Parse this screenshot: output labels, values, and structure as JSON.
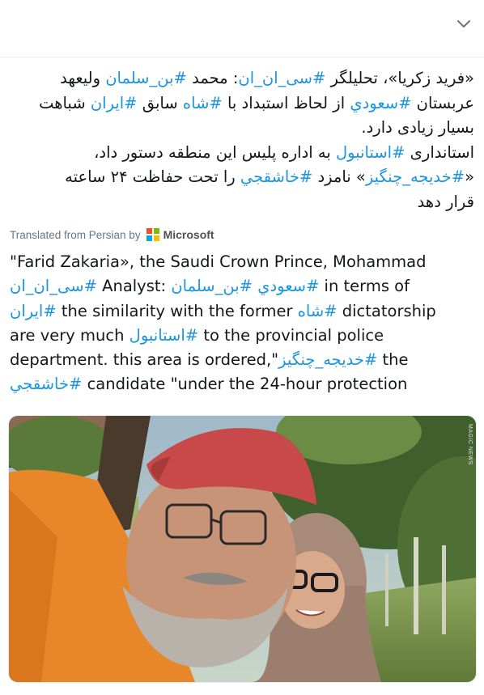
{
  "header": {
    "chevron_icon": "chevron-down-icon"
  },
  "tweet": {
    "persian_lines": [
      [
        {
          "t": "«فرید زکریا»، تحلیلگر ",
          "tag": false
        },
        {
          "t": "#سی_ان_ان",
          "tag": true
        },
        {
          "t": ": محمد ",
          "tag": false
        },
        {
          "t": "#بن_سلمان",
          "tag": true
        },
        {
          "t": " ولیعهد",
          "tag": false
        }
      ],
      [
        {
          "t": "عربستان ",
          "tag": false
        },
        {
          "t": "#سعودي",
          "tag": true
        },
        {
          "t": " از لحاظ استبداد با ",
          "tag": false
        },
        {
          "t": "#شاه",
          "tag": true
        },
        {
          "t": " سابق ",
          "tag": false
        },
        {
          "t": "#ایران",
          "tag": true
        },
        {
          "t": " شباهت",
          "tag": false
        }
      ],
      [
        {
          "t": "بسیار زیادی دارد.",
          "tag": false
        }
      ],
      [
        {
          "t": "استانداری ",
          "tag": false
        },
        {
          "t": "#استانبول",
          "tag": true
        },
        {
          "t": " به اداره پلیس این منطقه دستور داد،",
          "tag": false
        }
      ],
      [
        {
          "t": "«",
          "tag": false
        },
        {
          "t": "#خدیجه_چنگیز",
          "tag": true
        },
        {
          "t": "» نامزد ",
          "tag": false
        },
        {
          "t": "#خاشقجي",
          "tag": true
        },
        {
          "t": "  را تحت حفاظت ۲۴ ساعته",
          "tag": false
        }
      ],
      [
        {
          "t": "قرار دهد",
          "tag": false
        }
      ]
    ],
    "translated_label": "Translated from Persian by",
    "microsoft_label": "Microsoft",
    "ms_colors": [
      "#f25022",
      "#7fba00",
      "#00a4ef",
      "#ffb900"
    ],
    "english_lines": [
      [
        {
          "t": "\"Farid Zakaria», the Saudi Crown Prince, Mohammad",
          "tag": false
        }
      ],
      [
        {
          "t": "#سی_ان_ان",
          "tag": true
        },
        {
          "t": " Analyst: ",
          "tag": false
        },
        {
          "t": "#بن_سلمان",
          "tag": true
        },
        {
          "t": " ",
          "tag": false
        },
        {
          "t": "#سعودي",
          "tag": true
        },
        {
          "t": " in terms of",
          "tag": false
        }
      ],
      [
        {
          "t": "#ایران",
          "tag": true
        },
        {
          "t": " the similarity with the former ",
          "tag": false
        },
        {
          "t": "#شاه",
          "tag": true
        },
        {
          "t": " dictatorship",
          "tag": false
        }
      ],
      [
        {
          "t": "are very much ",
          "tag": false
        },
        {
          "t": "#استانبول",
          "tag": true
        },
        {
          "t": " to the provincial police",
          "tag": false
        }
      ],
      [
        {
          "t": "department. this area is ordered,\"",
          "tag": false
        },
        {
          "t": "#خدیجه_چنگیز",
          "tag": true
        },
        {
          "t": " the",
          "tag": false
        }
      ],
      [
        {
          "t": "#خاشقجي",
          "tag": true
        },
        {
          "t": " candidate \"under the 24-hour protection",
          "tag": false
        }
      ]
    ],
    "link_color": "#1b95e0"
  },
  "media": {
    "watermark": "MAGIC NEWS"
  }
}
